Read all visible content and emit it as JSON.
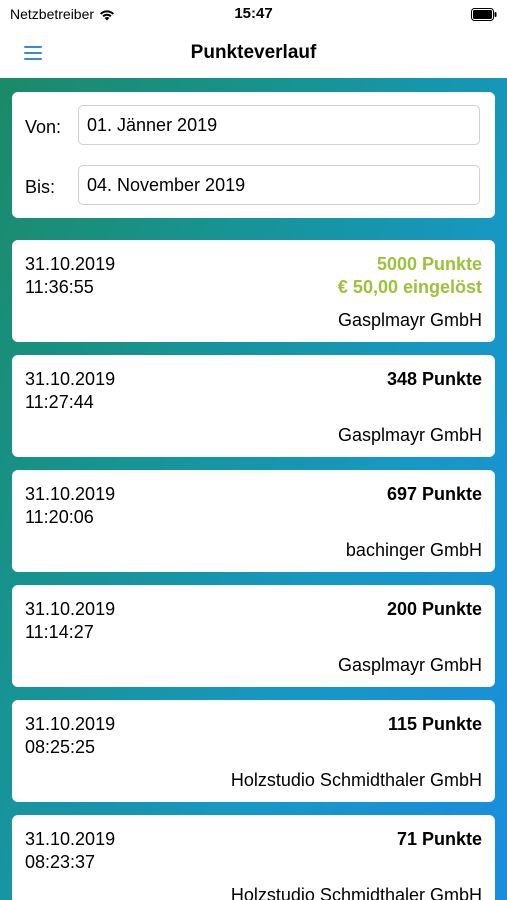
{
  "status_bar": {
    "carrier": "Netzbetreiber",
    "time": "15:47"
  },
  "nav": {
    "title": "Punkteverlauf"
  },
  "filter": {
    "from_label": "Von:",
    "from_value": "01. Jänner 2019",
    "to_label": "Bis:",
    "to_value": "04. November 2019"
  },
  "entries": [
    {
      "date": "31.10.2019",
      "time": "11:36:55",
      "points": "5000 Punkte",
      "redeemed": "€ 50,00 eingelöst",
      "company": "Gasplmayr GmbH"
    },
    {
      "date": "31.10.2019",
      "time": "11:27:44",
      "points": "348 Punkte",
      "company": "Gasplmayr GmbH"
    },
    {
      "date": "31.10.2019",
      "time": "11:20:06",
      "points": "697 Punkte",
      "company": "bachinger GmbH"
    },
    {
      "date": "31.10.2019",
      "time": "11:14:27",
      "points": "200 Punkte",
      "company": "Gasplmayr GmbH"
    },
    {
      "date": "31.10.2019",
      "time": "08:25:25",
      "points": "115 Punkte",
      "company": "Holzstudio Schmidthaler GmbH"
    },
    {
      "date": "31.10.2019",
      "time": "08:23:37",
      "points": "71 Punkte",
      "company": "Holzstudio Schmidthaler GmbH"
    }
  ],
  "colors": {
    "accent": "#3a8ad6",
    "redeemed": "#9cc23a",
    "gradient_start": "#1b8a66",
    "gradient_end": "#1a8ddf"
  }
}
